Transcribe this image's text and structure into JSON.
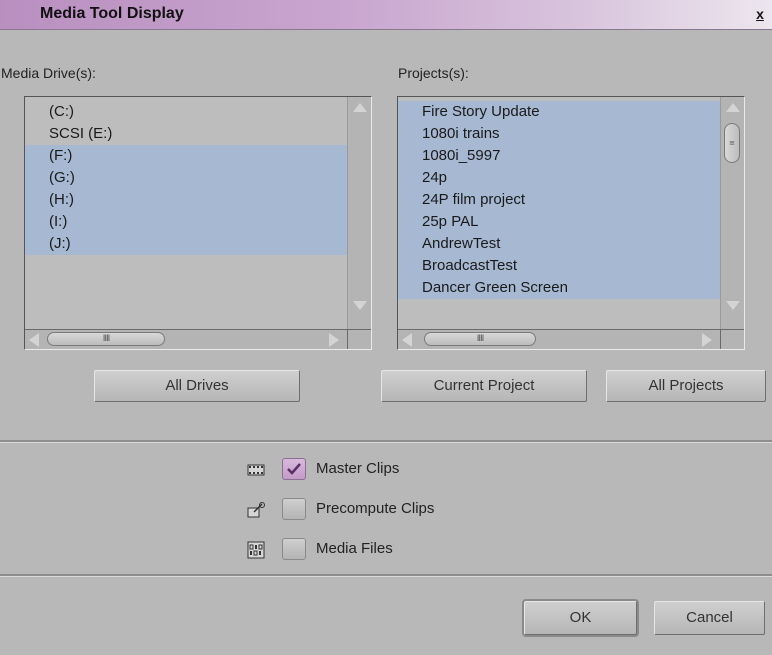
{
  "window": {
    "title": "Media Tool Display",
    "close_label": "x"
  },
  "media_drives": {
    "label": "Media Drive(s):",
    "items": [
      {
        "label": "(C:)",
        "selected": false
      },
      {
        "label": "SCSI (E:)",
        "selected": false
      },
      {
        "label": "(F:)",
        "selected": true
      },
      {
        "label": "(G:)",
        "selected": true
      },
      {
        "label": "(H:)",
        "selected": true
      },
      {
        "label": "(I:)",
        "selected": true
      },
      {
        "label": "(J:)",
        "selected": true
      }
    ],
    "all_drives_button": "All Drives"
  },
  "projects": {
    "label": "Projects(s):",
    "items": [
      {
        "label": "Fire Story Update",
        "selected": true
      },
      {
        "label": "1080i trains",
        "selected": true
      },
      {
        "label": "1080i_5997",
        "selected": true
      },
      {
        "label": "24p",
        "selected": true
      },
      {
        "label": "24P film project",
        "selected": true
      },
      {
        "label": "25p PAL",
        "selected": true
      },
      {
        "label": "AndrewTest",
        "selected": true
      },
      {
        "label": "BroadcastTest",
        "selected": true
      },
      {
        "label": "Dancer Green Screen",
        "selected": true
      }
    ],
    "current_project_button": "Current Project",
    "all_projects_button": "All Projects"
  },
  "options": [
    {
      "label": "Master Clips",
      "checked": true,
      "icon": "filmstrip-icon"
    },
    {
      "label": "Precompute Clips",
      "checked": false,
      "icon": "precompute-icon"
    },
    {
      "label": "Media Files",
      "checked": false,
      "icon": "media-file-icon"
    }
  ],
  "footer": {
    "ok_button": "OK",
    "cancel_button": "Cancel"
  },
  "colors": {
    "title_gradient_start": "#b98fc0",
    "selection": "#a6b8d2",
    "panel": "#b8b8b8",
    "checked_box": "#c39bc9"
  }
}
